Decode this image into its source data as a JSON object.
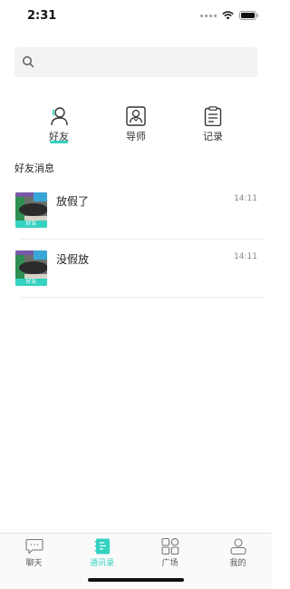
{
  "status_bar": {
    "time": "2:31"
  },
  "search": {
    "placeholder": ""
  },
  "tabs": [
    {
      "label": "好友",
      "icon": "person-icon",
      "active": true
    },
    {
      "label": "导师",
      "icon": "mentor-badge-icon",
      "active": false
    },
    {
      "label": "记录",
      "icon": "clipboard-icon",
      "active": false
    }
  ],
  "section": {
    "title": "好友消息"
  },
  "messages": [
    {
      "name": "放假了",
      "time": "14:11",
      "tag": "好友"
    },
    {
      "name": "没假放",
      "time": "14:11",
      "tag": "好友"
    }
  ],
  "bottom_nav": [
    {
      "label": "聊天",
      "icon": "chat-icon",
      "active": false
    },
    {
      "label": "通讯录",
      "icon": "contacts-book-icon",
      "active": true
    },
    {
      "label": "广场",
      "icon": "grid-icon",
      "active": false
    },
    {
      "label": "我的",
      "icon": "profile-icon",
      "active": false
    }
  ],
  "colors": {
    "accent": "#34d2c0"
  }
}
